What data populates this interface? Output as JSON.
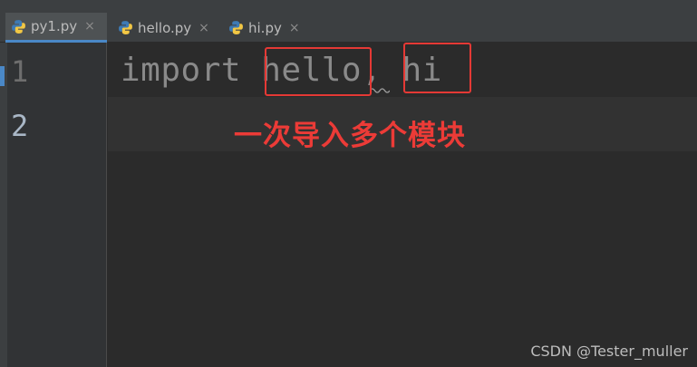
{
  "tabs": [
    {
      "label": "py1.py",
      "close": "×",
      "active": true
    },
    {
      "label": "hello.py",
      "close": "×",
      "active": false
    },
    {
      "label": "hi.py",
      "close": "×",
      "active": false
    }
  ],
  "gutter": {
    "line1": "1",
    "line2": "2"
  },
  "code": {
    "keyword": "import",
    "module1": "hello",
    "separator": ",",
    "module2": "hi"
  },
  "annotation": "一次导入多个模块",
  "watermark": "CSDN @Tester_muller",
  "colors": {
    "highlight_box": "#e53935",
    "annotation": "#ec3b37",
    "tab_accent": "#4a88c7"
  }
}
